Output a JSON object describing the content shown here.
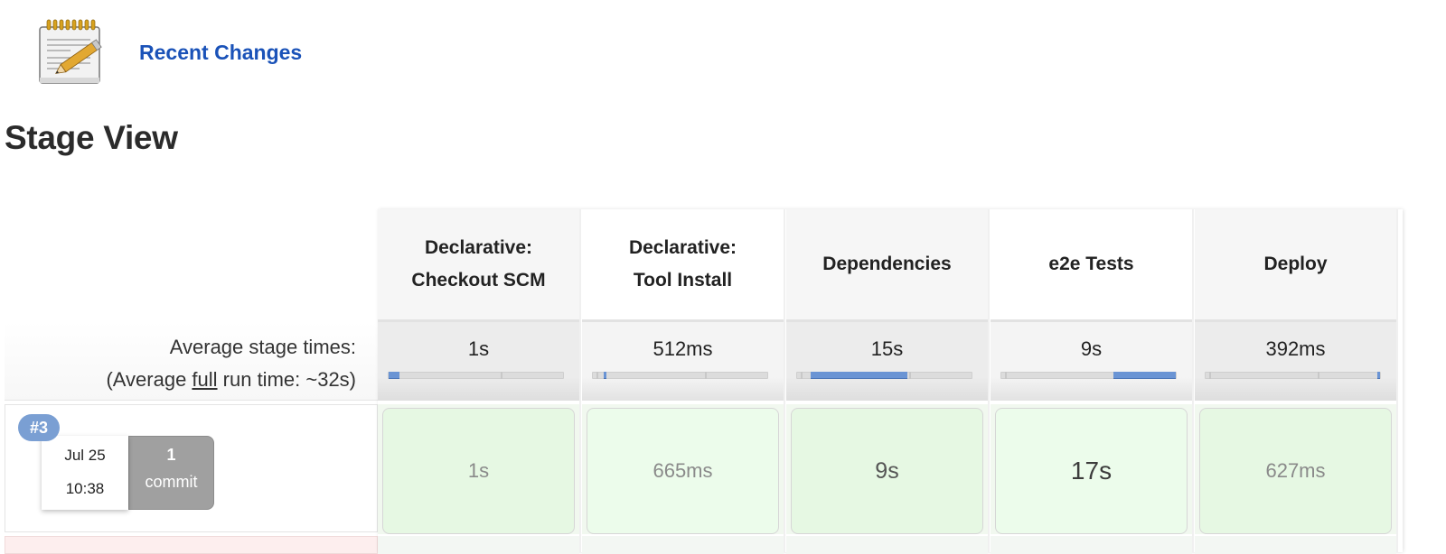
{
  "recent_changes": {
    "icon": "notepad-icon",
    "label": "Recent Changes"
  },
  "page_title": "Stage View",
  "summary": {
    "avg_stage_label": "Average stage times:",
    "avg_full_prefix": "(Average ",
    "avg_full_word": "full",
    "avg_full_suffix": " run time: ~32s)"
  },
  "stages": [
    {
      "name_line1": "Declarative:",
      "name_line2": "Checkout SCM",
      "avg_time": "1s",
      "avg_bar": {
        "start": 0.0,
        "end": 0.06
      },
      "run_time": "1s",
      "run_emphasis": 0
    },
    {
      "name_line1": "Declarative:",
      "name_line2": "Tool Install",
      "avg_time": "512ms",
      "avg_bar": {
        "start": 0.06,
        "end": 0.08
      },
      "run_time": "665ms",
      "run_emphasis": 0
    },
    {
      "name_line1": "Dependencies",
      "name_line2": "",
      "avg_time": "15s",
      "avg_bar": {
        "start": 0.08,
        "end": 0.63
      },
      "run_time": "9s",
      "run_emphasis": 1
    },
    {
      "name_line1": "e2e Tests",
      "name_line2": "",
      "avg_time": "9s",
      "avg_bar": {
        "start": 0.64,
        "end": 1.0
      },
      "run_time": "17s",
      "run_emphasis": 2
    },
    {
      "name_line1": "Deploy",
      "name_line2": "",
      "avg_time": "392ms",
      "avg_bar": {
        "start": 0.985,
        "end": 1.0
      },
      "run_time": "627ms",
      "run_emphasis": 0
    }
  ],
  "run": {
    "number": "#3",
    "date": "Jul 25",
    "time": "10:38",
    "commit_count": "1",
    "commit_label": "commit"
  },
  "colors": {
    "link": "#1a52b8",
    "badge": "#7a9fd3",
    "bar_fill": "#6a94d4",
    "success_cell": "#e6f8e3",
    "commit_box": "#a0a0a0"
  }
}
